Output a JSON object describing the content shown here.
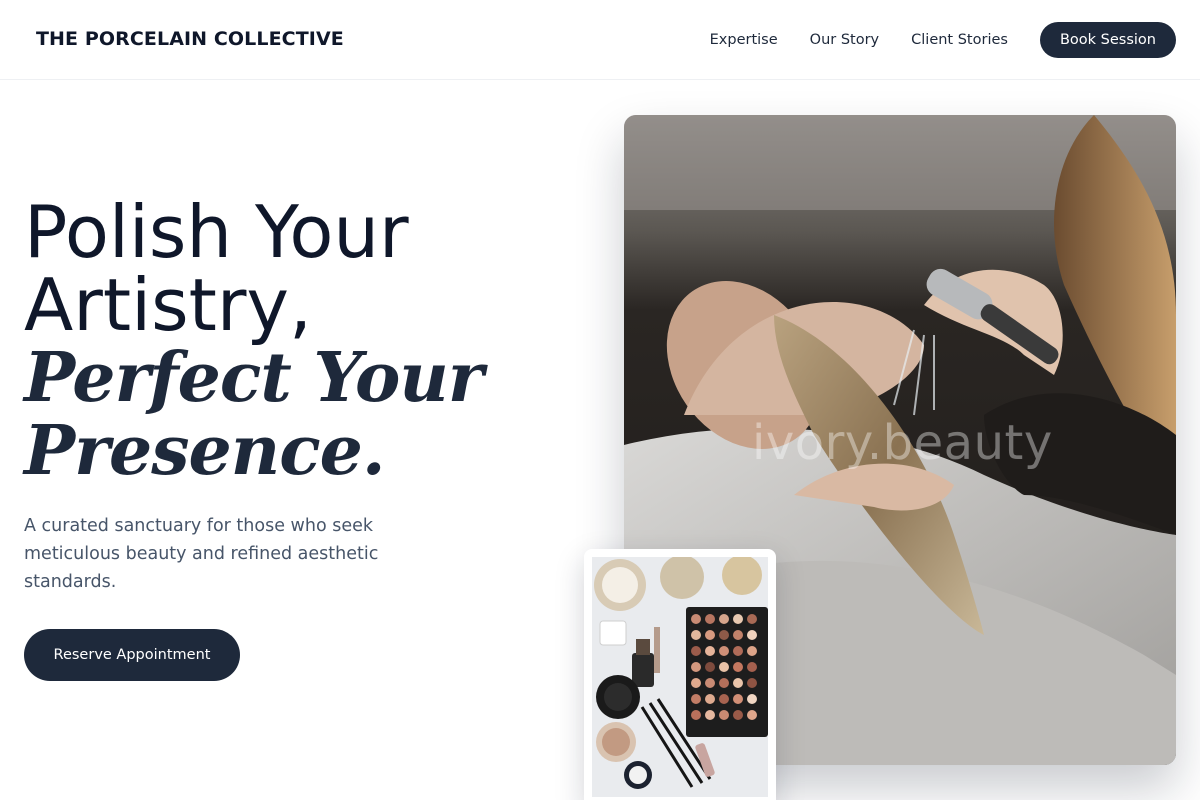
{
  "nav": {
    "brand": "THE PORCELAIN COLLECTIVE",
    "links": [
      "Expertise",
      "Our Story",
      "Client Stories"
    ],
    "cta_label": "Book Session"
  },
  "hero": {
    "headline_line1": "Polish Your",
    "headline_line2": "Artistry,",
    "headline_italic1": "Perfect Your",
    "headline_italic2": "Presence.",
    "subtitle": "A curated sanctuary for those who seek meticulous beauty and refined aesthetic standards.",
    "cta_label": "Reserve Appointment",
    "photo_watermark": "ivory.beauty"
  },
  "colors": {
    "primary": "#1e293b",
    "text_dark": "#0f172a",
    "text_muted": "#475569"
  }
}
